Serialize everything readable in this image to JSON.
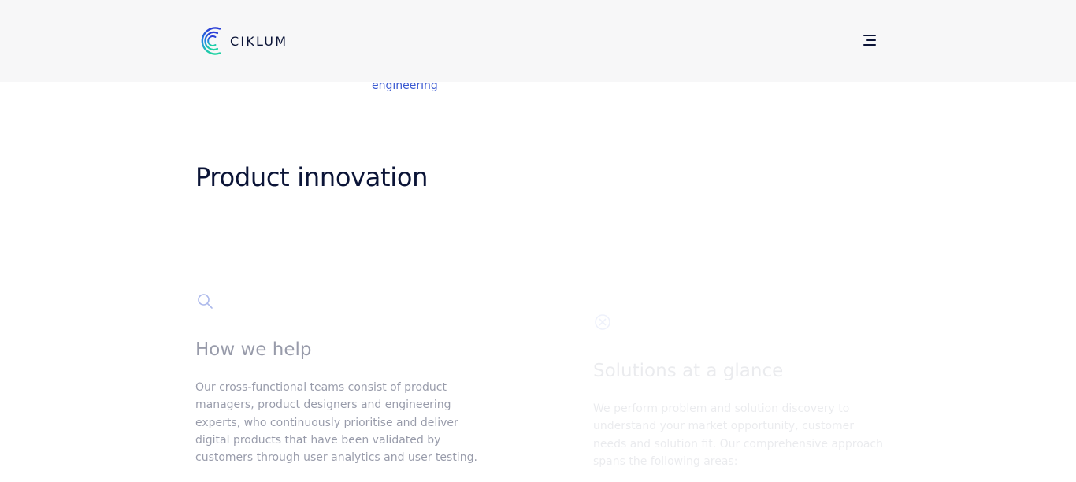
{
  "header": {
    "logo_text": "CIKLUM",
    "menu_icon": "hamburger-menu-icon"
  },
  "breadcrumb": {
    "label": "engineering"
  },
  "page": {
    "title": "Product innovation"
  },
  "sections": {
    "how_we_help": {
      "icon": "search-icon",
      "heading": "How we help",
      "text": "Our cross-functional teams consist of product managers, product designers and engineering experts, who continuously prioritise and deliver digital products that have been validated by customers through user analytics and user testing."
    },
    "solutions": {
      "icon": "target-icon",
      "heading": "Solutions at a glance",
      "text": "We perform problem and solution discovery to understand your market opportunity, customer needs and solution fit. Our comprehensive approach spans the following areas:"
    }
  },
  "colors": {
    "brand_dark": "#0b1437",
    "link_blue": "#3a59d1",
    "header_bg": "#f7f7f8"
  }
}
